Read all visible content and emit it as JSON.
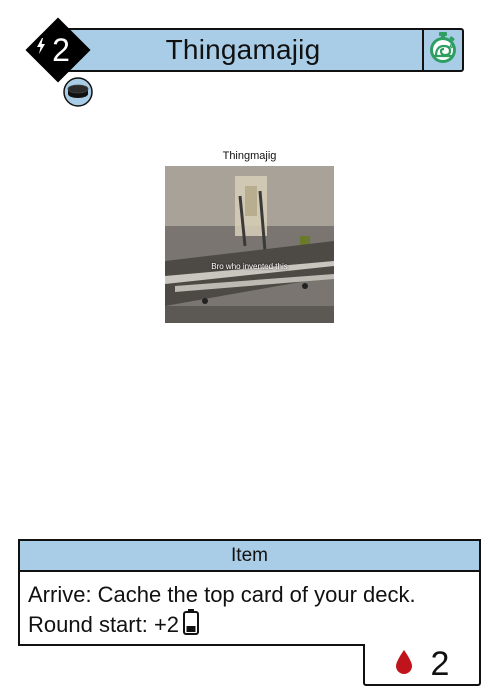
{
  "card": {
    "title": "Thingamajig",
    "cost": "2",
    "type_line": "Item",
    "rules_line1": "Arrive: Cache the top card of your deck.",
    "rules_line2": "Round start: +2",
    "power": "2",
    "art_caption": "Thingmajig",
    "art_overlay_text": "Bro who invented this"
  },
  "icons": {
    "cost_modifier": "lightning-bolt-icon",
    "timing": "snail-stopwatch-icon",
    "token": "puck-token-icon",
    "energy": "battery-icon",
    "power": "blood-drop-icon"
  },
  "colors": {
    "banner": "#a9cde6",
    "timer_green": "#2e9e63",
    "drop_red": "#c0141c"
  }
}
